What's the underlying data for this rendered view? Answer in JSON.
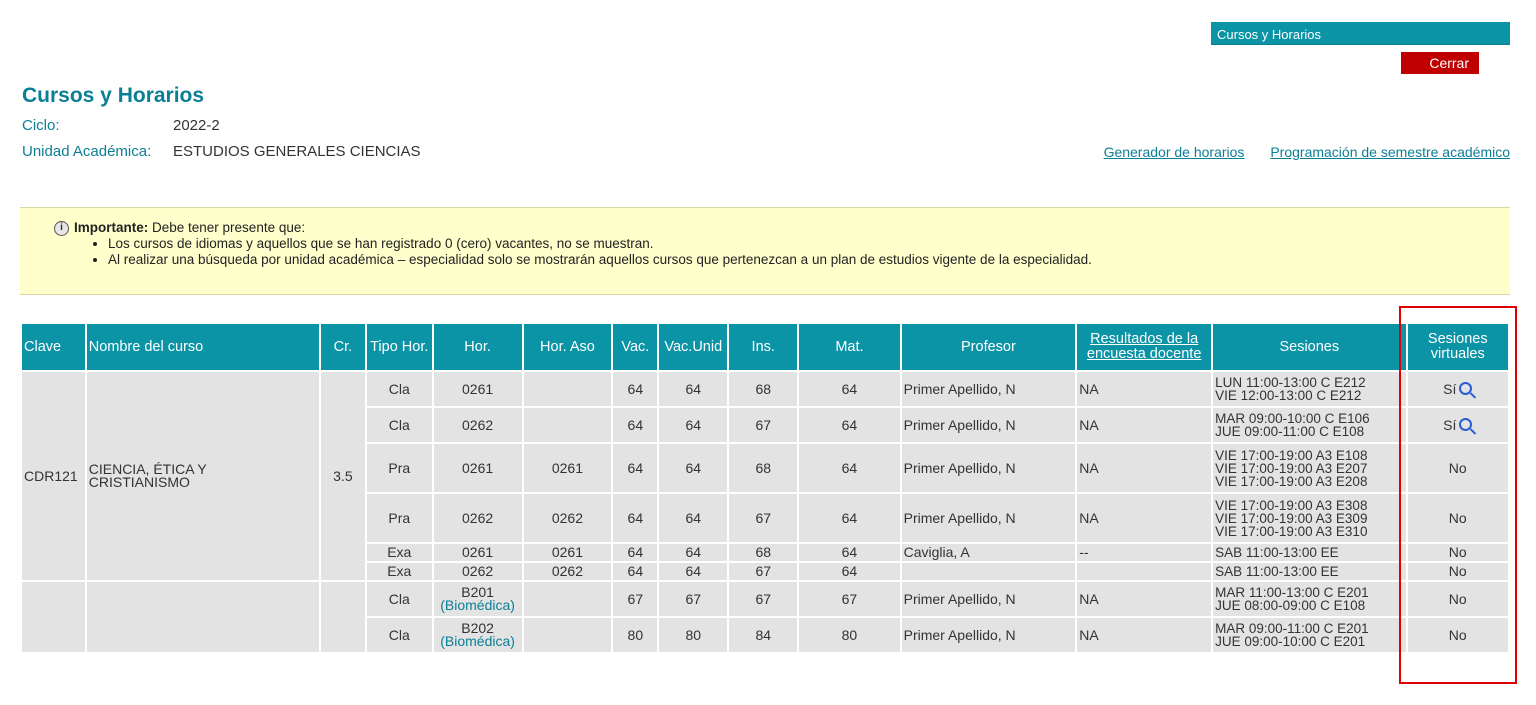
{
  "topbar": {
    "title": "Cursos y Horarios",
    "close_label": "Cerrar"
  },
  "page": {
    "title": "Cursos y Horarios",
    "ciclo_label": "Ciclo:",
    "ciclo_value": "2022-2",
    "unidad_label": "Unidad Académica:",
    "unidad_value": "ESTUDIOS GENERALES CIENCIAS"
  },
  "links": {
    "generador": "Generador de horarios",
    "programacion": "Programación de semestre académico"
  },
  "notice": {
    "strong": "Importante:",
    "text": " Debe tener presente que:",
    "items": [
      "Los cursos de idiomas y aquellos que se han registrado 0 (cero) vacantes, no se muestran.",
      "Al realizar una búsqueda por unidad académica – especialidad solo se mostrarán aquellos cursos que pertenezcan a un plan de estudios vigente de la especialidad."
    ]
  },
  "table": {
    "headers": {
      "clave": "Clave",
      "nombre": "Nombre del curso",
      "cr": "Cr.",
      "tipo": "Tipo Hor.",
      "hor": "Hor.",
      "horaso": "Hor. Aso",
      "vac": "Vac.",
      "vacunid": "Vac.Unid",
      "ins": "Ins.",
      "mat": "Mat.",
      "profesor": "Profesor",
      "resultados_1": "Resultados de la",
      "resultados_2": "encuesta docente",
      "sesiones": "Sesiones",
      "virtuales_1": "Sesiones",
      "virtuales_2": "virtuales"
    },
    "course1": {
      "clave": "CDR121",
      "nombre_1": "CIENCIA, ÉTICA Y",
      "nombre_2": "CRISTIANISMO",
      "cr": "3.5"
    },
    "rows": [
      {
        "tipo": "Cla",
        "hor": "0261",
        "horaso": "",
        "vac": "64",
        "vacunid": "64",
        "ins": "68",
        "mat": "64",
        "profesor": "Primer Apellido, N",
        "resultados": "NA",
        "ses_1": "LUN 11:00-13:00 C E212",
        "ses_2": "VIE 12:00-13:00 C E212",
        "ses_3": "",
        "virtual": "Sí"
      },
      {
        "tipo": "Cla",
        "hor": "0262",
        "horaso": "",
        "vac": "64",
        "vacunid": "64",
        "ins": "67",
        "mat": "64",
        "profesor": "Primer Apellido, N",
        "resultados": "NA",
        "ses_1": "MAR 09:00-10:00 C E106",
        "ses_2": "JUE 09:00-11:00 C E108",
        "ses_3": "",
        "virtual": "Sí"
      },
      {
        "tipo": "Pra",
        "hor": "0261",
        "horaso": "0261",
        "vac": "64",
        "vacunid": "64",
        "ins": "68",
        "mat": "64",
        "profesor": "Primer Apellido, N",
        "resultados": "NA",
        "ses_1": "VIE 17:00-19:00 A3 E108",
        "ses_2": "VIE 17:00-19:00 A3 E207",
        "ses_3": "VIE 17:00-19:00 A3 E208",
        "virtual": "No"
      },
      {
        "tipo": "Pra",
        "hor": "0262",
        "horaso": "0262",
        "vac": "64",
        "vacunid": "64",
        "ins": "67",
        "mat": "64",
        "profesor": "Primer Apellido, N",
        "resultados": "NA",
        "ses_1": "VIE 17:00-19:00 A3 E308",
        "ses_2": "VIE 17:00-19:00 A3 E309",
        "ses_3": "VIE 17:00-19:00 A3 E310",
        "virtual": "No"
      },
      {
        "tipo": "Exa",
        "hor": "0261",
        "horaso": "0261",
        "vac": "64",
        "vacunid": "64",
        "ins": "68",
        "mat": "64",
        "profesor": "Caviglia, A",
        "resultados": "--",
        "ses_1": "SAB 11:00-13:00 EE",
        "ses_2": "",
        "ses_3": "",
        "virtual": "No"
      },
      {
        "tipo": "Exa",
        "hor": "0262",
        "horaso": "0262",
        "vac": "64",
        "vacunid": "64",
        "ins": "67",
        "mat": "64",
        "profesor": "",
        "resultados": "",
        "ses_1": "SAB 11:00-13:00 EE",
        "ses_2": "",
        "ses_3": "",
        "virtual": "No"
      }
    ],
    "rows2": [
      {
        "tipo": "Cla",
        "hor": "B201",
        "hor_sub": "(Biomédica)",
        "horaso": "",
        "vac": "67",
        "vacunid": "67",
        "ins": "67",
        "mat": "67",
        "profesor": "Primer Apellido, N",
        "resultados": "NA",
        "ses_1": "MAR 11:00-13:00 C E201",
        "ses_2": "JUE 08:00-09:00 C E108",
        "virtual": "No"
      },
      {
        "tipo": "Cla",
        "hor": "B202",
        "hor_sub": "(Biomédica)",
        "horaso": "",
        "vac": "80",
        "vacunid": "80",
        "ins": "84",
        "mat": "80",
        "profesor": "Primer Apellido, N",
        "resultados": "NA",
        "ses_1": "MAR 09:00-11:00 C E201",
        "ses_2": "JUE 09:00-10:00 C E201",
        "virtual": "No"
      }
    ]
  },
  "colors": {
    "teal": "#0b93a6",
    "title_teal": "#0b7f96",
    "close_red": "#c00000",
    "notice_bg": "#ffffcc",
    "cell_bg": "#e3e3e3",
    "highlight": "#e00000"
  }
}
